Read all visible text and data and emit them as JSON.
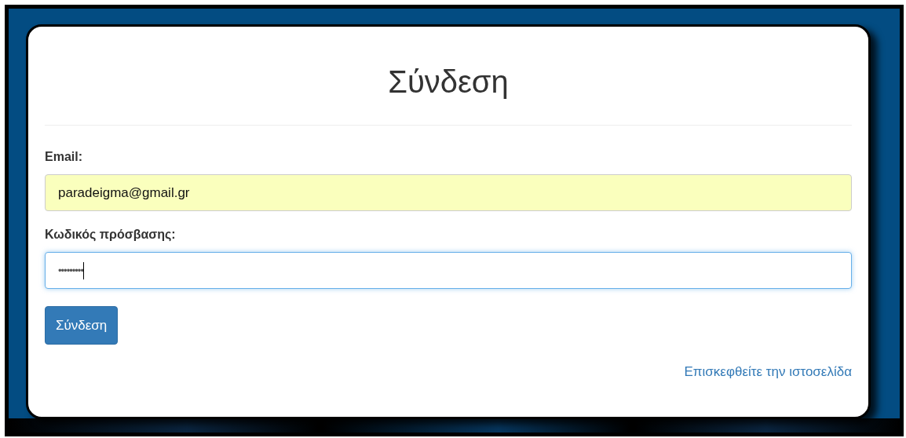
{
  "title": "Σύνδεση",
  "fields": [
    {
      "label": "Email:",
      "value": "paradeigma@gmail.gr",
      "autofilled": true,
      "focused": false
    },
    {
      "label": "Κωδικός πρόσβασης:",
      "value": "•••••••••",
      "autofilled": false,
      "focused": true
    }
  ],
  "submit_button": "Σύνδεση",
  "link": "Επισκεφθείτε την ιστοσελίδα"
}
